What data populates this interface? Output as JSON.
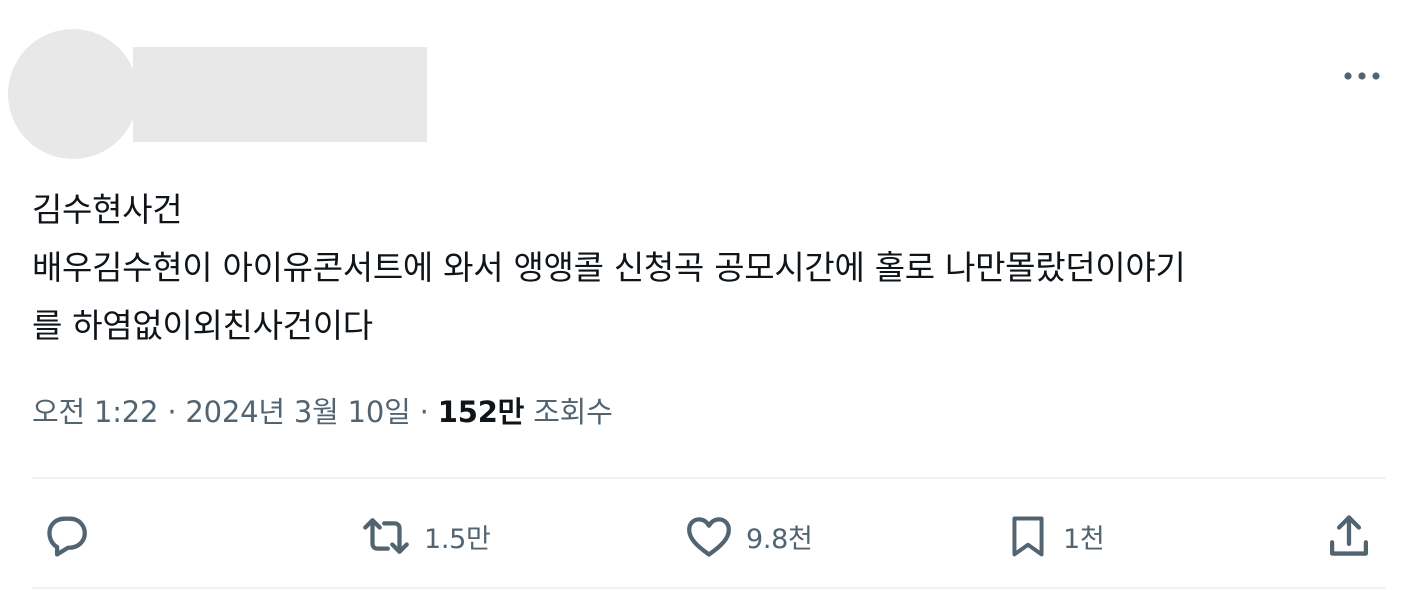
{
  "tweet": {
    "text": "김수현사건\n배우김수현이 아이유콘서트에 와서 앵앵콜 신청곡 공모시간에 홀로 나만몰랐던이야기\n를 하염없이외친사건이다",
    "time": "오전 1:22",
    "separator": "·",
    "date": "2024년 3월 10일",
    "views_count": "152만",
    "views_label": "조회수"
  },
  "actions": {
    "reply": {
      "icon": "reply-icon",
      "count": ""
    },
    "retweet": {
      "icon": "retweet-icon",
      "count": "1.5만"
    },
    "like": {
      "icon": "heart-icon",
      "count": "9.8천"
    },
    "bookmark": {
      "icon": "bookmark-icon",
      "count": "1천"
    },
    "share": {
      "icon": "share-icon"
    }
  },
  "colors": {
    "text": "#0f1419",
    "secondary": "#536471",
    "divider": "#eff3f4",
    "placeholder": "#e8e8e8"
  }
}
